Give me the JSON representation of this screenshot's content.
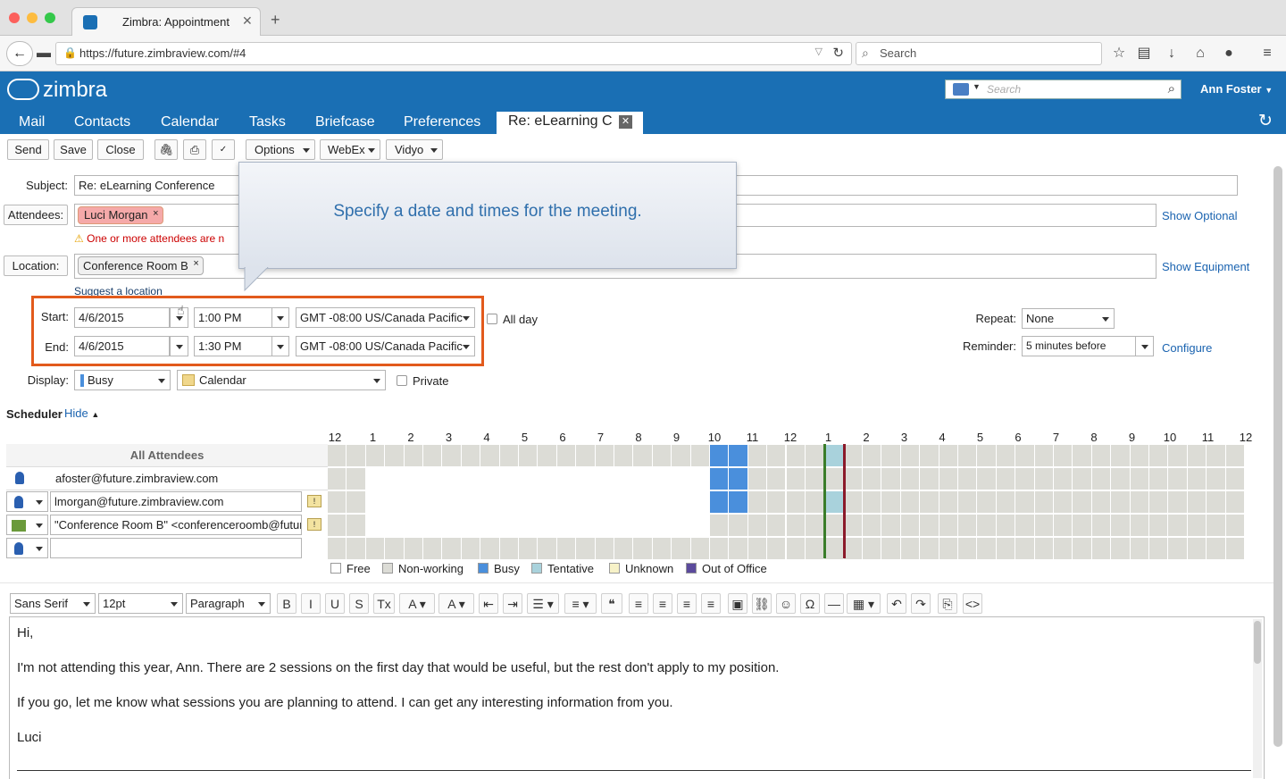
{
  "browser": {
    "tab_title": "Zimbra: Appointment",
    "new_tab": "+",
    "url": "https://future.zimbraview.com/#4",
    "search_placeholder": "Search"
  },
  "app": {
    "logo": "zimbra",
    "search_placeholder": "Search",
    "user": "Ann Foster",
    "nav_tabs": [
      "Mail",
      "Contacts",
      "Calendar",
      "Tasks",
      "Briefcase",
      "Preferences"
    ],
    "active_tab": "Re: eLearning C"
  },
  "toolbar": {
    "send": "Send",
    "save": "Save",
    "close": "Close",
    "options": "Options",
    "webex": "WebEx",
    "vidyo": "Vidyo"
  },
  "form": {
    "subject_label": "Subject:",
    "subject_value": "Re: eLearning Conference",
    "attendees_label": "Attendees:",
    "attendee_chip": "Luci Morgan",
    "warning": "One or more attendees are n",
    "show_optional": "Show Optional",
    "location_label": "Location:",
    "location_chip": "Conference Room B",
    "show_equipment": "Show Equipment",
    "suggest_location": "Suggest a location",
    "start_label": "Start:",
    "start_date": "4/6/2015",
    "start_time": "1:00 PM",
    "start_tz": "GMT -08:00 US/Canada Pacific",
    "end_label": "End:",
    "end_date": "4/6/2015",
    "end_time": "1:30 PM",
    "end_tz": "GMT -08:00 US/Canada Pacific",
    "all_day": "All day",
    "repeat_label": "Repeat:",
    "repeat_value": "None",
    "reminder_label": "Reminder:",
    "reminder_value": "5 minutes before",
    "configure": "Configure",
    "display_label": "Display:",
    "display_value": "Busy",
    "calendar_value": "Calendar",
    "private": "Private"
  },
  "tooltip": "Specify a date and times for the meeting.",
  "scheduler": {
    "title": "Scheduler",
    "hide": "Hide",
    "all_attendees": "All Attendees",
    "hours": [
      "12",
      "1",
      "2",
      "3",
      "4",
      "5",
      "6",
      "7",
      "8",
      "9",
      "10",
      "11",
      "12",
      "1",
      "2",
      "3",
      "4",
      "5",
      "6",
      "7",
      "8",
      "9",
      "10",
      "11",
      "12"
    ],
    "rows": [
      "afoster@future.zimbraview.com",
      "lmorgan@future.zimbraview.com",
      "\"Conference Room B\" <conferenceroomb@future.z",
      ""
    ],
    "legend": [
      "Free",
      "Non-working",
      "Busy",
      "Tentative",
      "Unknown",
      "Out of Office"
    ],
    "legend_colors": [
      "#ffffff",
      "#dcdcd6",
      "#4a8fdc",
      "#a9d2dc",
      "#f7f2c8",
      "#5b4a9c"
    ]
  },
  "editor": {
    "font": "Sans Serif",
    "size": "12pt",
    "block": "Paragraph",
    "body": [
      "Hi,",
      "I'm not attending this year, Ann. There are 2 sessions on the first day that would be useful, but the rest don't apply to my position.",
      "If you go, let me know what sessions you are planning to attend. I can get any interesting information from you.",
      "Luci"
    ]
  }
}
